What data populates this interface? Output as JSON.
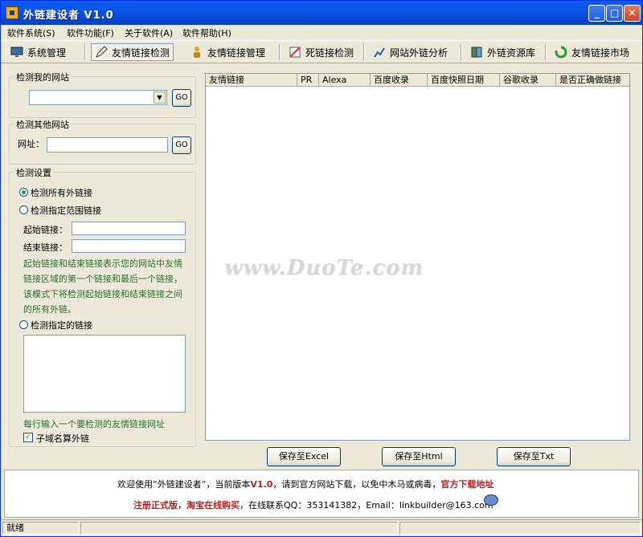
{
  "window": {
    "title": "外链建设者 V1.0"
  },
  "menu": [
    "软件系统(S)",
    "软件功能(F)",
    "关于软件(A)",
    "软件帮助(H)"
  ],
  "toolbar": [
    {
      "label": "系统管理",
      "icon": "monitor-icon"
    },
    {
      "label": "友情链接检测",
      "icon": "pen-icon",
      "active": true
    },
    {
      "label": "友情链接管理",
      "icon": "users-icon"
    },
    {
      "label": "死链接检测",
      "icon": "broken-link-icon"
    },
    {
      "label": "网站外链分析",
      "icon": "analyze-icon"
    },
    {
      "label": "外链资源库",
      "icon": "book-icon"
    },
    {
      "label": "友情链接市场",
      "icon": "recycle-icon"
    }
  ],
  "my_site": {
    "title": "检测我的网站",
    "go": "GO"
  },
  "other_site": {
    "title": "检测其他网站",
    "url_label": "网址：",
    "go": "GO"
  },
  "settings": {
    "title": "检测设置",
    "opt_all": "检测所有外链接",
    "opt_range": "检测指定范围链接",
    "start_label": "起始链接：",
    "end_label": "结束链接：",
    "help_lines": [
      "起始链接和结束链接表示您的网站中友情",
      "链接区域的第一个链接和最后一个链接，",
      "该模式下将检测起始链接和结束链接之间",
      "的所有外链。"
    ],
    "opt_specified": "检测指定的链接",
    "hint": "每行输入一个要检测的友情链接网址",
    "subdomain": "子域名算外链"
  },
  "table": {
    "columns": [
      "友情链接",
      "PR",
      "Alexa",
      "百度收录",
      "百度快照日期",
      "谷歌收录",
      "是否正确做链接"
    ]
  },
  "watermark": "www.DuoTe.com",
  "buttons": {
    "excel": "保存至Excel",
    "html": "保存至Html",
    "txt": "保存至Txt"
  },
  "footer": {
    "line1_a": "欢迎使用“外链建设者”，当前版本",
    "line1_ver": "V1.0",
    "line1_b": "，请到官方网站下载，以免中木马或病毒，",
    "line1_link": "官方下载地址",
    "line2_reg": "注册正式版",
    "line2_buy": "淘宝在线购买",
    "line2_contact": "，在线联系QQ：353141382，Email：linkbuilder@163.com"
  },
  "status": {
    "text": "就绪"
  },
  "colors": {
    "titlebar": "#0a5cf0",
    "accent_red": "#b22222",
    "green_text": "#2d6e2d"
  }
}
